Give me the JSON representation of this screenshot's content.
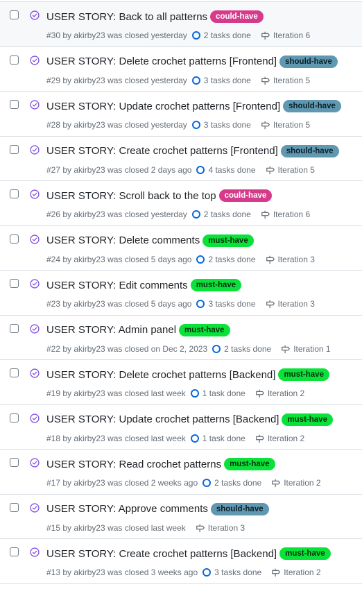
{
  "colors": {
    "could-have": {
      "bg": "#d63a8a",
      "fg": "#ffffff"
    },
    "should-have": {
      "bg": "#5f98b0",
      "fg": "#0d1f2a"
    },
    "must-have": {
      "bg": "#0ae23a",
      "fg": "#06300f"
    },
    "closed_icon": "#8250df"
  },
  "issues": [
    {
      "title": "USER STORY: Back to all patterns",
      "label": "could-have",
      "meta": "#30 by akirby23 was closed yesterday",
      "tasks": "2 tasks done",
      "iteration": "Iteration 6"
    },
    {
      "title": "USER STORY: Delete crochet patterns [Frontend]",
      "label": "should-have",
      "meta": "#29 by akirby23 was closed yesterday",
      "tasks": "3 tasks done",
      "iteration": "Iteration 5"
    },
    {
      "title": "USER STORY: Update crochet patterns [Frontend]",
      "label": "should-have",
      "meta": "#28 by akirby23 was closed yesterday",
      "tasks": "3 tasks done",
      "iteration": "Iteration 5"
    },
    {
      "title": "USER STORY: Create crochet patterns [Frontend]",
      "label": "should-have",
      "meta": "#27 by akirby23 was closed 2 days ago",
      "tasks": "4 tasks done",
      "iteration": "Iteration 5"
    },
    {
      "title": "USER STORY: Scroll back to the top",
      "label": "could-have",
      "meta": "#26 by akirby23 was closed yesterday",
      "tasks": "2 tasks done",
      "iteration": "Iteration 6"
    },
    {
      "title": "USER STORY: Delete comments",
      "label": "must-have",
      "meta": "#24 by akirby23 was closed 5 days ago",
      "tasks": "2 tasks done",
      "iteration": "Iteration 3"
    },
    {
      "title": "USER STORY: Edit comments",
      "label": "must-have",
      "meta": "#23 by akirby23 was closed 5 days ago",
      "tasks": "3 tasks done",
      "iteration": "Iteration 3"
    },
    {
      "title": "USER STORY: Admin panel",
      "label": "must-have",
      "meta": "#22 by akirby23 was closed on Dec 2, 2023",
      "tasks": "2 tasks done",
      "iteration": "Iteration 1"
    },
    {
      "title": "USER STORY: Delete crochet patterns [Backend]",
      "label": "must-have",
      "meta": "#19 by akirby23 was closed last week",
      "tasks": "1 task done",
      "iteration": "Iteration 2"
    },
    {
      "title": "USER STORY: Update crochet patterns [Backend]",
      "label": "must-have",
      "meta": "#18 by akirby23 was closed last week",
      "tasks": "1 task done",
      "iteration": "Iteration 2"
    },
    {
      "title": "USER STORY: Read crochet patterns",
      "label": "must-have",
      "meta": "#17 by akirby23 was closed 2 weeks ago",
      "tasks": "2 tasks done",
      "iteration": "Iteration 2"
    },
    {
      "title": "USER STORY: Approve comments",
      "label": "should-have",
      "meta": "#15 by akirby23 was closed last week",
      "tasks": null,
      "iteration": "Iteration 3"
    },
    {
      "title": "USER STORY: Create crochet patterns [Backend]",
      "label": "must-have",
      "meta": "#13 by akirby23 was closed 3 weeks ago",
      "tasks": "3 tasks done",
      "iteration": "Iteration 2"
    }
  ]
}
